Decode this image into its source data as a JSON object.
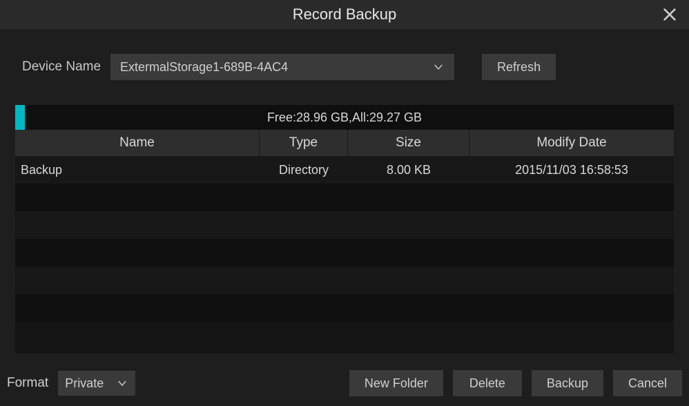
{
  "title": "Record Backup",
  "device": {
    "label": "Device Name",
    "selected": "ExtermalStorage1-689B-4AC4",
    "refresh_label": "Refresh"
  },
  "storage": {
    "free": "28.96 GB",
    "all": "29.27 GB",
    "text": "Free:28.96 GB,All:29.27 GB",
    "used_percent": 1.06
  },
  "table": {
    "headers": {
      "name": "Name",
      "type": "Type",
      "size": "Size",
      "modify": "Modify Date"
    },
    "rows": [
      {
        "name": "Backup",
        "type": "Directory",
        "size": "8.00 KB",
        "modify": "2015/11/03 16:58:53"
      }
    ]
  },
  "footer": {
    "format_label": "Format",
    "format_value": "Private",
    "new_folder": "New Folder",
    "delete": "Delete",
    "backup": "Backup",
    "cancel": "Cancel"
  }
}
